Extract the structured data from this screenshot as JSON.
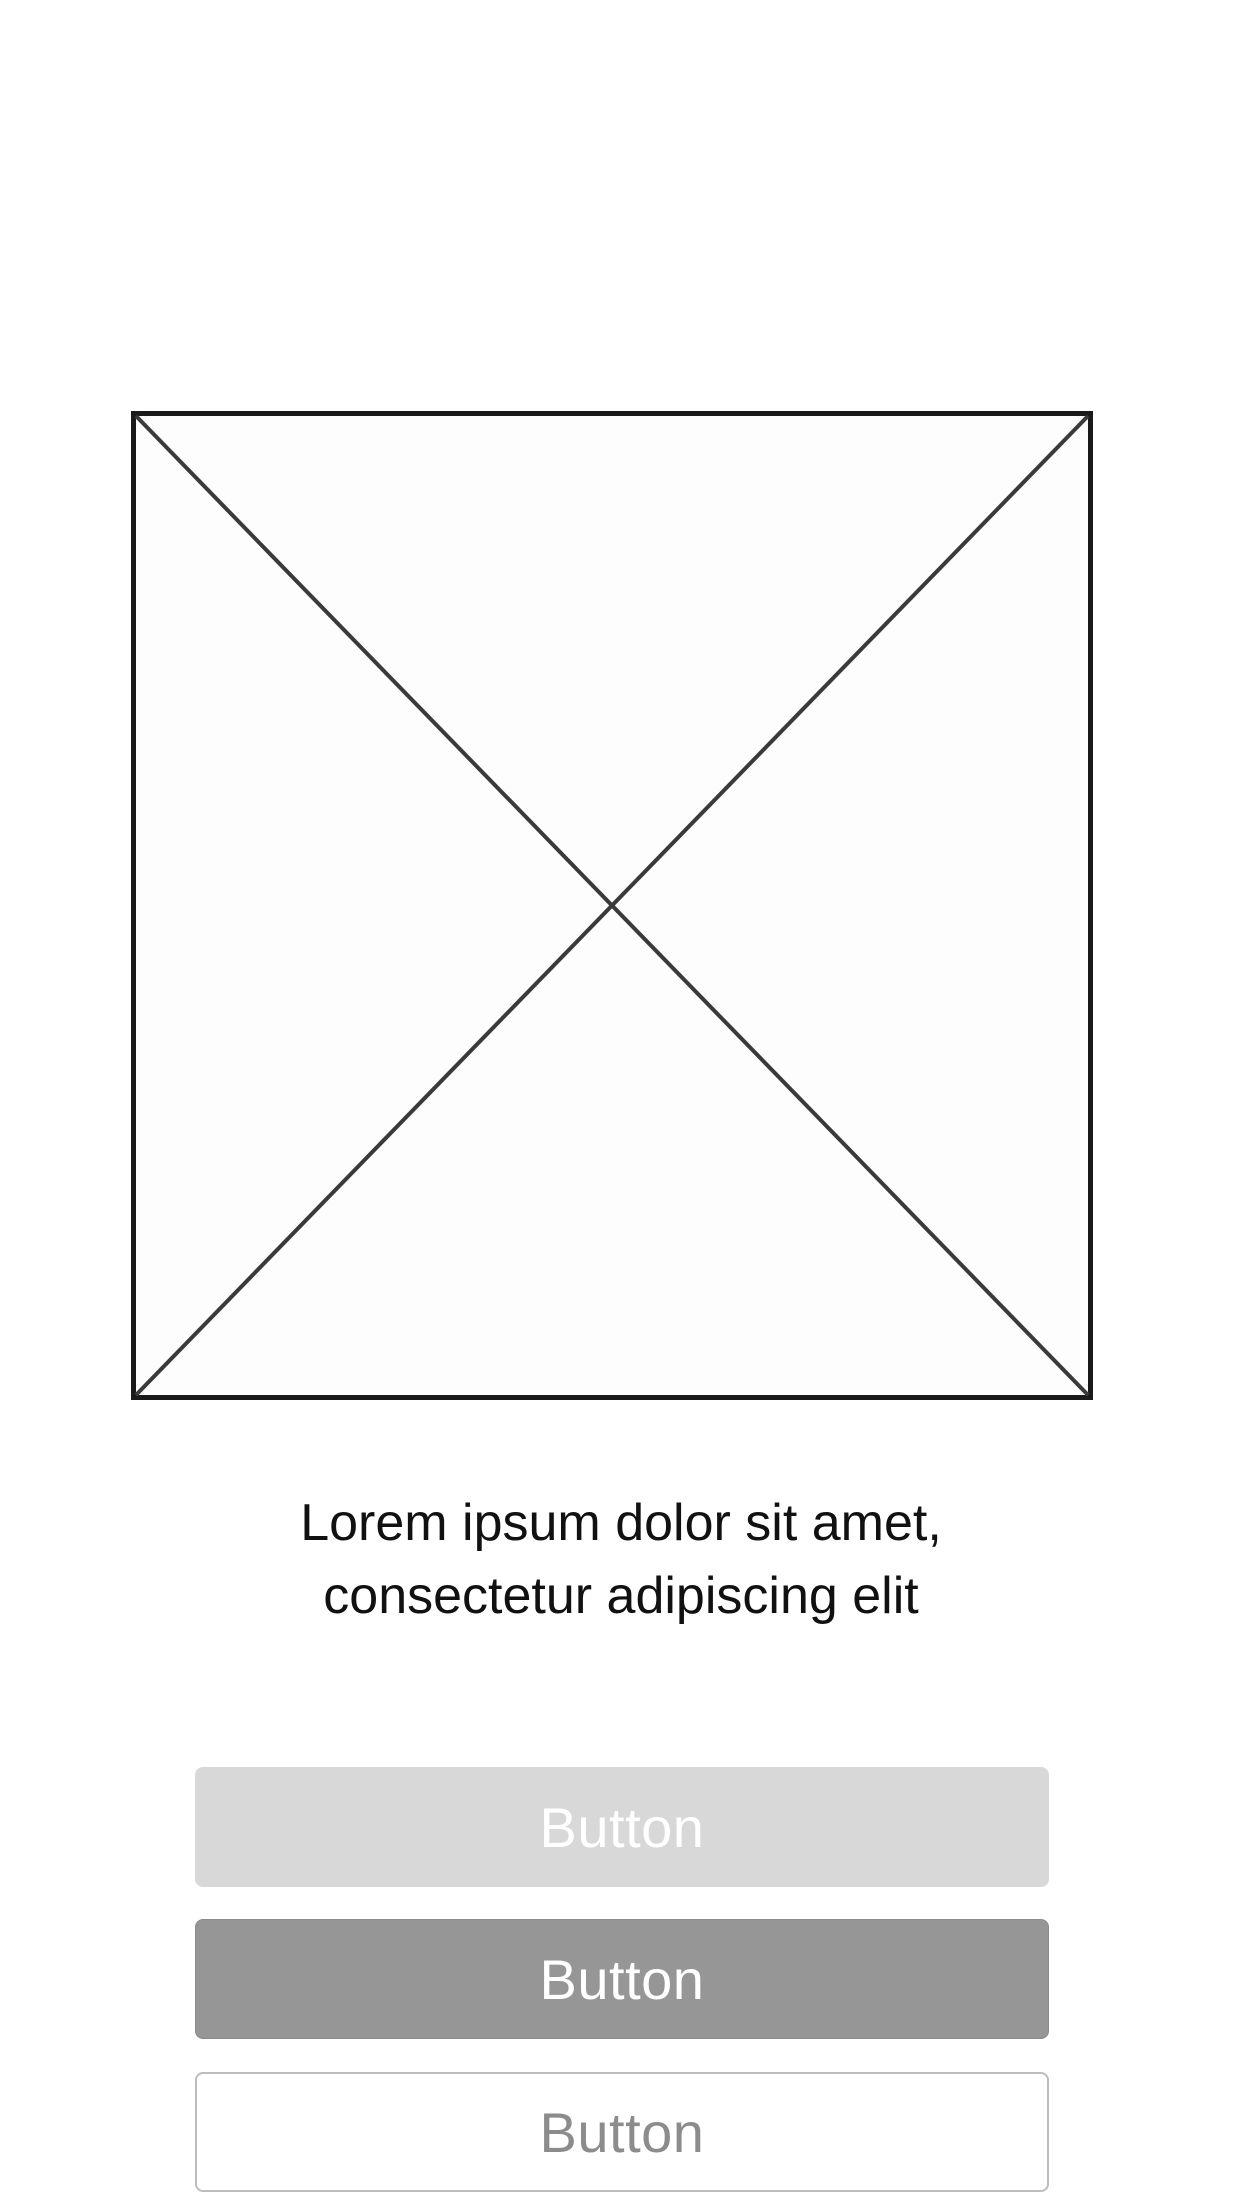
{
  "image": {
    "icon": "image-placeholder-icon",
    "stroke_color": "#1a1a1a",
    "diagonal_color": "#3a3a3a"
  },
  "caption": {
    "line1": "Lorem ipsum dolor sit amet,",
    "line2": "consectetur adipiscing elit"
  },
  "buttons": [
    {
      "label": "Button",
      "style": "light",
      "background": "#d8d8d8",
      "text_color": "#ffffff"
    },
    {
      "label": "Button",
      "style": "dark",
      "background": "#969696",
      "text_color": "#ffffff"
    },
    {
      "label": "Button",
      "style": "outline",
      "background": "#ffffff",
      "text_color": "#8c8c8c"
    }
  ]
}
